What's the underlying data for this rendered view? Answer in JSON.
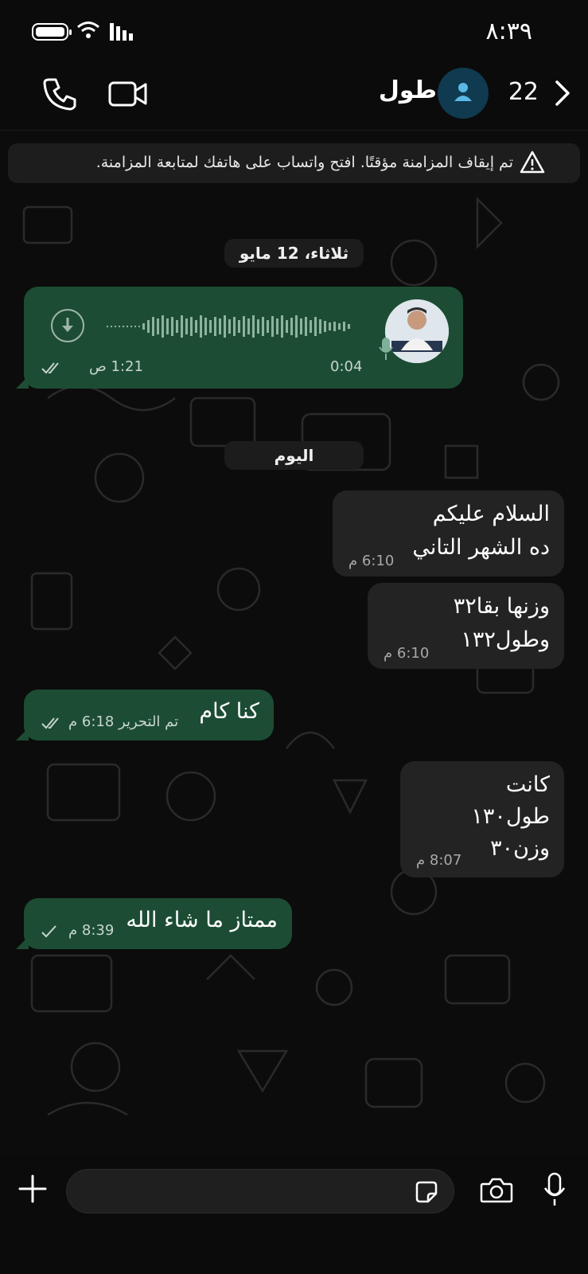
{
  "status_bar": {
    "time": "٨:٣٩"
  },
  "header": {
    "contact_name": "طول",
    "contact_suffix": "ٍ",
    "unread_count": "22",
    "icons": [
      "phone-icon",
      "video-call-icon",
      "avatar-icon",
      "chevron-right-icon"
    ]
  },
  "sync_banner": {
    "text": "تم إيقاف المزامنة مؤقتًا. افتح واتساب على هاتفك لمتابعة المزامنة."
  },
  "date_chips": {
    "first": "ثلاثاء، 12 مايو",
    "today": "اليوم"
  },
  "messages": [
    {
      "direction": "out",
      "type": "voice",
      "duration": "0:04",
      "time": "1:21 ص",
      "status": "read"
    },
    {
      "direction": "in",
      "lines": [
        "السلام عليكم",
        "ده الشهر التاني"
      ],
      "time": "6:10 م"
    },
    {
      "direction": "in",
      "lines": [
        "وزنها بقا٣٢",
        "وطول١٣٢"
      ],
      "time": "6:10 م"
    },
    {
      "direction": "out",
      "lines": [
        "كنا كام"
      ],
      "time": "تم التحرير 6:18 م",
      "status": "read"
    },
    {
      "direction": "in",
      "lines": [
        "كانت",
        "طول١٣٠",
        "وزن٣٠"
      ],
      "time": "8:07 م"
    },
    {
      "direction": "out",
      "lines": [
        "ممتاز ما شاء الله"
      ],
      "time": "8:39 م",
      "status": "sent"
    }
  ],
  "colors": {
    "outgoing_bubble": "#1c4d34",
    "incoming_bubble": "#232323",
    "background": "#0c0c0c",
    "read_tick": "#c7d5cc"
  }
}
